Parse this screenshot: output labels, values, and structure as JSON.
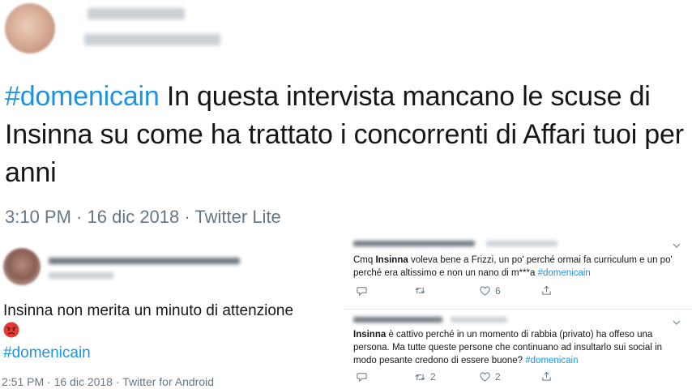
{
  "main_tweet": {
    "hashtag": "#domenicain",
    "text": " In questa intervista  mancano le scuse di Insinna su come ha trattato i concorrenti di Affari tuoi per anni",
    "time": "3:10 PM",
    "sep1": " · ",
    "date": "16 dic 2018",
    "sep2": " · ",
    "source": "Twitter Lite"
  },
  "left_tweet": {
    "text": "Insinna non merita un minuto di attenzione",
    "emoji_icon": "angry-face-icon",
    "hashtag": "#domenicain",
    "meta": "2:51 PM · 16 dic 2018 · Twitter for Android"
  },
  "replies": [
    {
      "prefix": "Cmq ",
      "bold": "Insinna",
      "text": " voleva bene a Frizzi, un po' perché ormai fa curriculum e un po' perché era altissimo e non un nano di m***a ",
      "hashtag": "#domenicain",
      "reply_count": "",
      "retweet_count": "",
      "like_count": "6"
    },
    {
      "prefix": "",
      "bold": "Insinna",
      "text": " è cattivo perché in un momento di rabbia (privato) ha offeso una persona. Ma tutte queste persone che continuano ad insultarlo sui social in modo pesante credono di essere buone? ",
      "hashtag": "#domenicain",
      "reply_count": "",
      "retweet_count": "2",
      "like_count": "2"
    }
  ],
  "colors": {
    "hashtag": "#1b95e0",
    "meta": "#657786",
    "text": "#14171a",
    "angry_face": "#e53935"
  }
}
